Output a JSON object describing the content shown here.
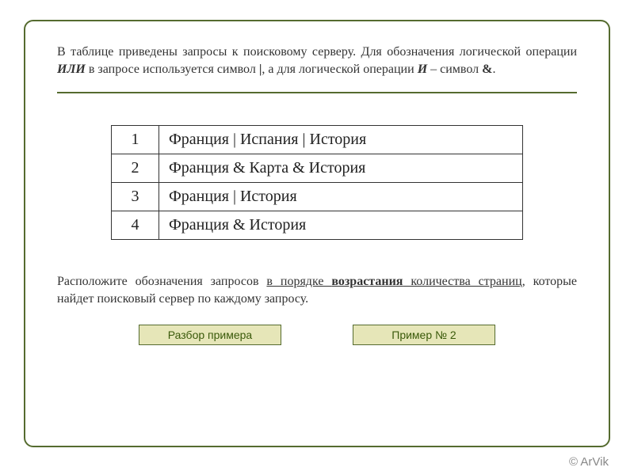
{
  "intro": {
    "part1": "В таблице приведены запросы к поисковому серверу. Для обозначения логической операции ",
    "or": "ИЛИ",
    "part2": " в запросе используется символ ",
    "pipe_sym": "|",
    "part3": ", а для логической операции ",
    "and": "И",
    "part4": " – символ ",
    "amp_sym": "&",
    "part5": "."
  },
  "table": {
    "rows": [
      {
        "n": "1",
        "q": "Франция | Испания | История"
      },
      {
        "n": "2",
        "q": "Франция & Карта & История"
      },
      {
        "n": "3",
        "q": "Франция | История"
      },
      {
        "n": "4",
        "q": "Франция & История"
      }
    ]
  },
  "task": {
    "part1": "Расположите обозначения запросов ",
    "ul1": "в порядке ",
    "ul_bold": "возрастания",
    "ul2": " количества страниц",
    "part2": ", которые найдет поисковый сервер по каждому запросу."
  },
  "buttons": {
    "left": "Разбор примера",
    "right": "Пример № 2"
  },
  "copyright": "© ArVik"
}
